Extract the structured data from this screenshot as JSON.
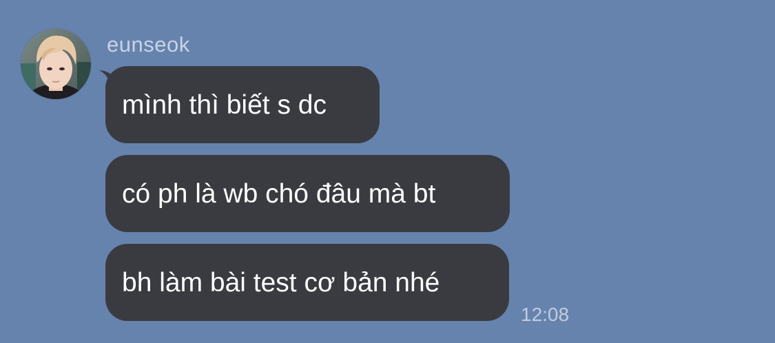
{
  "chat": {
    "sender_name": "eunseok",
    "avatar_icon": "user-photo-avatar",
    "messages": [
      {
        "text": "mình thì biết s dc"
      },
      {
        "text": "có ph là wb chó đâu mà bt"
      },
      {
        "text": "bh làm bài test cơ bản nhé"
      }
    ],
    "timestamp": "12:08"
  },
  "colors": {
    "background": "#6683ae",
    "bubble": "#3a3b40",
    "bubble_text": "#ffffff",
    "meta_text": "#c9d3e4"
  }
}
